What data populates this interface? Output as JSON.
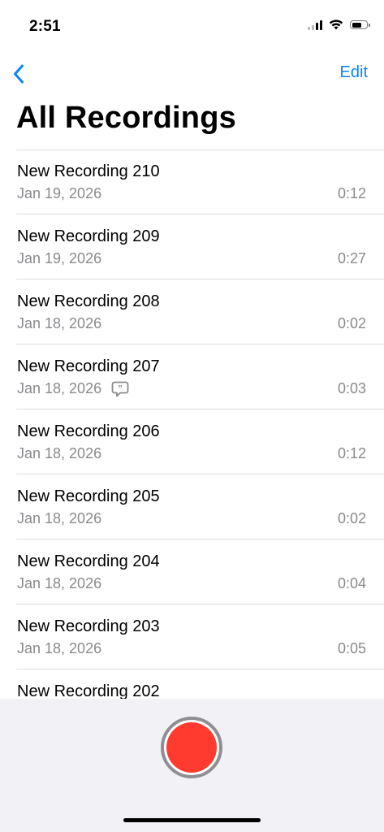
{
  "status_bar": {
    "time": "2:51",
    "icons": [
      "cellular-signal-icon",
      "wifi-icon",
      "battery-icon"
    ],
    "battery_level": 0.7
  },
  "nav": {
    "back_icon": "chevron-left-icon",
    "edit_label": "Edit",
    "title": "All Recordings"
  },
  "recordings": [
    {
      "title": "New Recording 210",
      "date": "Jan 19, 2026",
      "duration": "0:12",
      "has_transcript": false
    },
    {
      "title": "New Recording 209",
      "date": "Jan 19, 2026",
      "duration": "0:27",
      "has_transcript": false
    },
    {
      "title": "New Recording 208",
      "date": "Jan 18, 2026",
      "duration": "0:02",
      "has_transcript": false
    },
    {
      "title": "New Recording 207",
      "date": "Jan 18, 2026",
      "duration": "0:03",
      "has_transcript": true
    },
    {
      "title": "New Recording 206",
      "date": "Jan 18, 2026",
      "duration": "0:12",
      "has_transcript": false
    },
    {
      "title": "New Recording 205",
      "date": "Jan 18, 2026",
      "duration": "0:02",
      "has_transcript": false
    },
    {
      "title": "New Recording 204",
      "date": "Jan 18, 2026",
      "duration": "0:04",
      "has_transcript": false
    },
    {
      "title": "New Recording 203",
      "date": "Jan 18, 2026",
      "duration": "0:05",
      "has_transcript": false
    },
    {
      "title": "New Recording 202",
      "date": "",
      "duration": "",
      "has_transcript": false
    }
  ],
  "bottom_bar": {
    "record_icon": "record-button-icon"
  },
  "colors": {
    "accent": "#0a84ff",
    "record": "#ff3b30",
    "secondary_text": "#8a8a8e",
    "bottom_bar_bg": "#f2f2f6"
  }
}
